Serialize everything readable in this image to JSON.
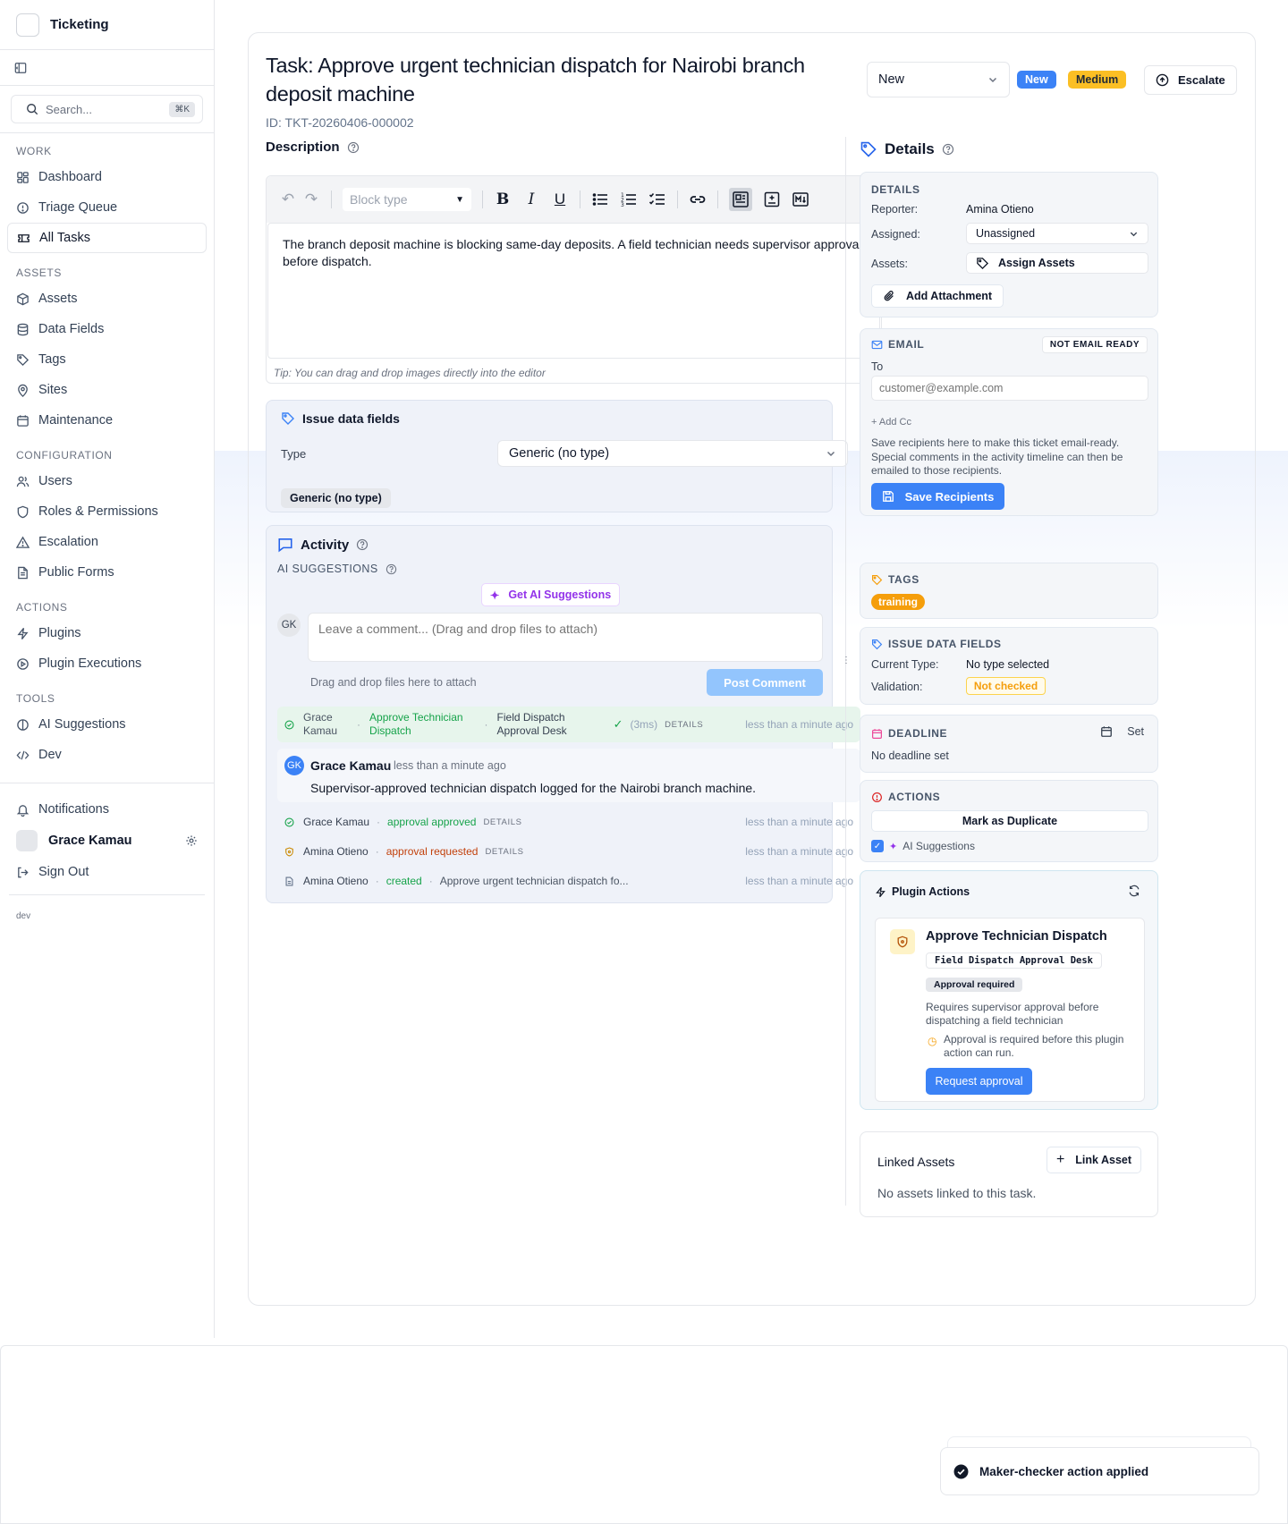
{
  "sidebar": {
    "app_title": "Ticketing",
    "search_placeholder": "Search...",
    "search_shortcut": "⌘K",
    "sections": {
      "work": "WORK",
      "assets": "ASSETS",
      "configuration": "CONFIGURATION",
      "actions": "ACTIONS",
      "tools": "TOOLS"
    },
    "items": {
      "dashboard": "Dashboard",
      "triage": "Triage Queue",
      "all_tasks": "All Tasks",
      "assets": "Assets",
      "data_fields": "Data Fields",
      "tags": "Tags",
      "sites": "Sites",
      "maintenance": "Maintenance",
      "users": "Users",
      "roles": "Roles & Permissions",
      "escalation": "Escalation",
      "public_forms": "Public Forms",
      "plugins": "Plugins",
      "plugin_executions": "Plugin Executions",
      "ai_suggestions": "AI Suggestions",
      "dev": "Dev",
      "notifications": "Notifications",
      "sign_out": "Sign Out"
    },
    "user_name": "Grace Kamau",
    "env": "dev"
  },
  "task": {
    "title": "Task: Approve urgent technician dispatch for Nairobi branch deposit machine",
    "id_label": "ID: TKT-20260406-000002",
    "status_value": "New",
    "status_badge": "New",
    "priority_badge": "Medium",
    "escalate_label": "Escalate"
  },
  "description": {
    "label": "Description",
    "block_type_placeholder": "Block type",
    "body": "The branch deposit machine is blocking same-day deposits. A field technician needs supervisor approval before dispatch.",
    "tip": "Tip: You can drag and drop images directly into the editor"
  },
  "issue_data_fields": {
    "label": "Issue data fields",
    "type_label": "Type",
    "type_value": "Generic (no type)",
    "chip": "Generic (no type)"
  },
  "activity": {
    "label": "Activity",
    "ai_label": "AI SUGGESTIONS",
    "get_ai_button": "Get AI Suggestions",
    "avatar_initials": "GK",
    "comment_placeholder": "Leave a comment... (Drag and drop files to attach)",
    "drag_hint": "Drag and drop files here to attach",
    "post_button": "Post Comment",
    "plugin_row": {
      "user_line1": "Grace",
      "user_line2": "Kamau",
      "action_line1": "Approve Technician",
      "action_line2": "Dispatch",
      "target_line1": "Field Dispatch",
      "target_line2": "Approval Desk",
      "duration": "(3ms)",
      "details": "DETAILS",
      "time": "less than a minute ago"
    },
    "comment": {
      "initials": "GK",
      "author": "Grace Kamau",
      "time": "less than a minute ago",
      "text": "Supervisor-approved technician dispatch logged for the Nairobi branch machine."
    },
    "events": [
      {
        "user": "Grace Kamau",
        "action": "approval approved",
        "extra": "DETAILS",
        "time": "less than a minute ago"
      },
      {
        "user": "Amina Otieno",
        "action": "approval requested",
        "extra": "DETAILS",
        "time": "less than a minute ago"
      },
      {
        "user": "Amina Otieno",
        "action": "created",
        "extra": "Approve urgent technician dispatch fo...",
        "time": "less than a minute ago"
      }
    ]
  },
  "details": {
    "heading": "Details",
    "section": "DETAILS",
    "reporter_label": "Reporter:",
    "reporter_value": "Amina Otieno",
    "assigned_label": "Assigned:",
    "assigned_value": "Unassigned",
    "assets_label": "Assets:",
    "assets_button": "Assign Assets",
    "attachment_button": "Add Attachment"
  },
  "email": {
    "section": "EMAIL",
    "badge": "NOT EMAIL READY",
    "to_label": "To",
    "to_placeholder": "customer@example.com",
    "add_cc": "+ Add Cc",
    "help": "Save recipients here to make this ticket email-ready. Special comments in the activity timeline can then be emailed to those recipients.",
    "save_button": "Save Recipients"
  },
  "tags": {
    "section": "TAGS",
    "tag": "training"
  },
  "issue_fields_side": {
    "section": "ISSUE DATA FIELDS",
    "current_type_label": "Current Type:",
    "current_type_value": "No type selected",
    "validation_label": "Validation:",
    "validation_value": "Not checked"
  },
  "deadline": {
    "section": "DEADLINE",
    "set_label": "Set",
    "value": "No deadline set"
  },
  "actions_panel": {
    "section": "ACTIONS",
    "duplicate_button": "Mark as Duplicate",
    "ai_toggle": "AI Suggestions"
  },
  "plugin_actions": {
    "title": "Plugin Actions",
    "card_title": "Approve Technician Dispatch",
    "card_target": "Field Dispatch Approval Desk",
    "card_badge": "Approval required",
    "card_desc": "Requires supervisor approval before dispatching a field technician",
    "card_warning": "Approval is required before this plugin action can run.",
    "request_button": "Request approval"
  },
  "linked_assets": {
    "title": "Linked Assets",
    "link_button": "Link Asset",
    "empty": "No assets linked to this task."
  },
  "toast": {
    "message": "Maker-checker action applied"
  },
  "colors": {
    "accent": "#3b82f6",
    "success": "#16a34a",
    "warning": "#f59e0b",
    "ai_purple": "#9333ea"
  }
}
